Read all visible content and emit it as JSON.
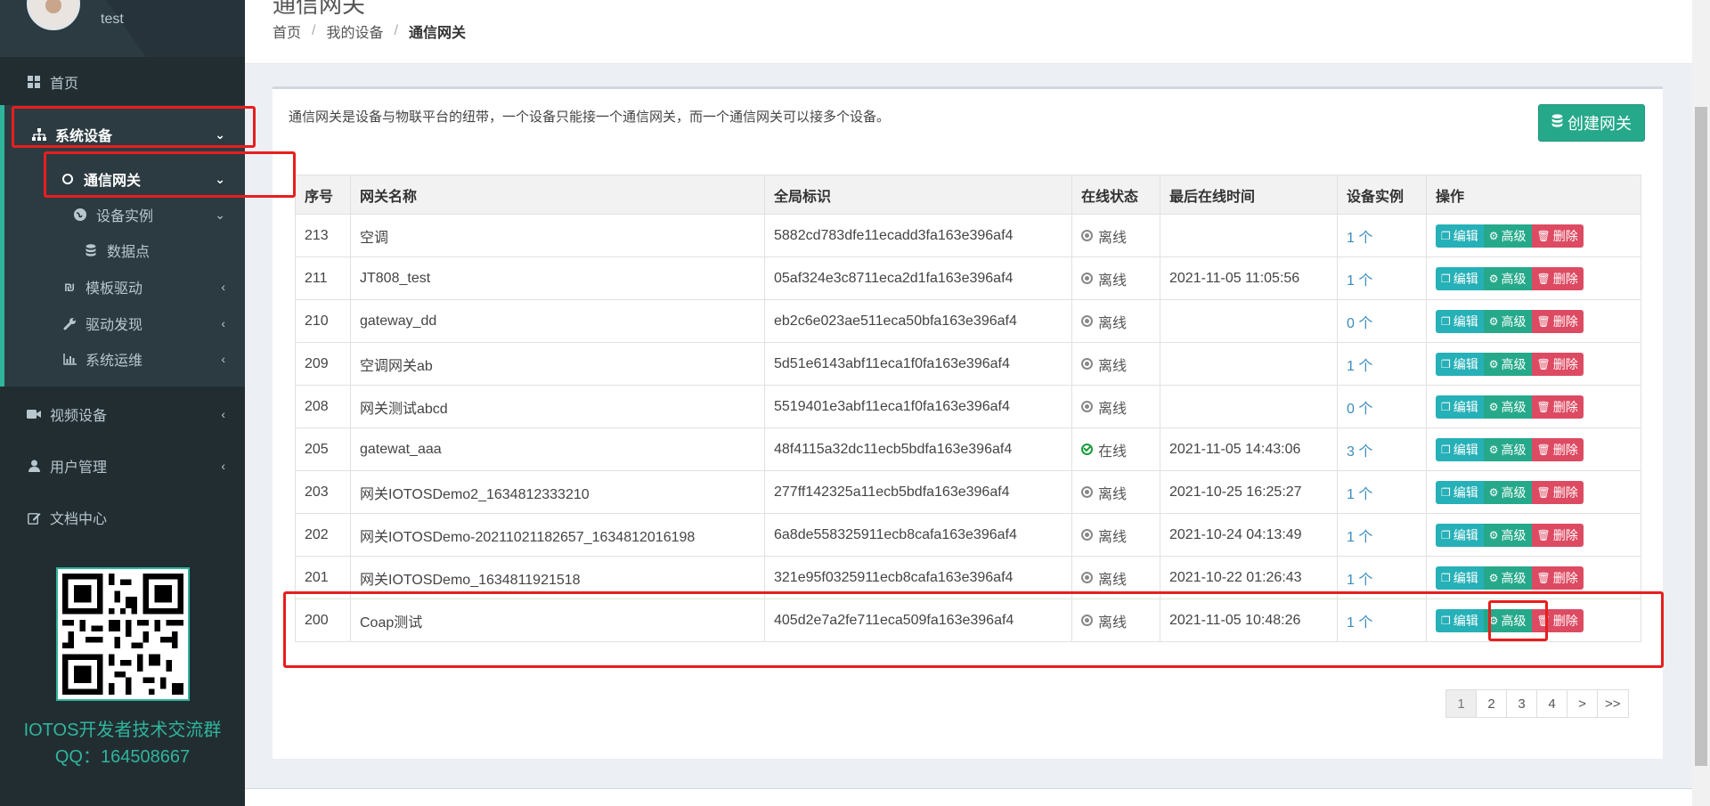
{
  "user": {
    "name": "test"
  },
  "sidebar": {
    "items": [
      {
        "label": "首页",
        "icon": "dashboard-icon"
      },
      {
        "label": "系统设备",
        "icon": "sitemap-icon"
      },
      {
        "label": "通信网关",
        "icon": "circle-icon"
      },
      {
        "label": "设备实例",
        "icon": "globe-icon"
      },
      {
        "label": "数据点",
        "icon": "database-icon"
      },
      {
        "label": "模板驱动",
        "icon": "template-icon"
      },
      {
        "label": "驱动发现",
        "icon": "wrench-icon"
      },
      {
        "label": "系统运维",
        "icon": "chart-icon"
      },
      {
        "label": "视频设备",
        "icon": "video-icon"
      },
      {
        "label": "用户管理",
        "icon": "user-icon"
      },
      {
        "label": "文档中心",
        "icon": "edit-icon"
      }
    ],
    "qr_line1": "IOTOS开发者技术交流群",
    "qr_line2": "QQ：164508667"
  },
  "header": {
    "title": "通信网关",
    "breadcrumb": [
      "首页",
      "我的设备",
      "通信网关"
    ]
  },
  "main": {
    "intro": "通信网关是设备与物联平台的纽带，一个设备只能接一个通信网关，而一个通信网关可以接多个设备。",
    "create_label": "创建网关",
    "columns": [
      "序号",
      "网关名称",
      "全局标识",
      "在线状态",
      "最后在线时间",
      "设备实例",
      "操作"
    ],
    "actions": {
      "edit": "编辑",
      "advanced": "高级",
      "delete": "删除"
    },
    "rows": [
      {
        "no": "213",
        "name": "空调",
        "gid": "5882cd783dfe11ecadd3fa163e396af4",
        "status": "离线",
        "online": false,
        "last": "",
        "count": "1 个"
      },
      {
        "no": "211",
        "name": "JT808_test",
        "gid": "05af324e3c8711eca2d1fa163e396af4",
        "status": "离线",
        "online": false,
        "last": "2021-11-05 11:05:56",
        "count": "1 个"
      },
      {
        "no": "210",
        "name": "gateway_dd",
        "gid": "eb2c6e023ae511eca50bfa163e396af4",
        "status": "离线",
        "online": false,
        "last": "",
        "count": "0 个"
      },
      {
        "no": "209",
        "name": "空调网关ab",
        "gid": "5d51e6143abf11eca1f0fa163e396af4",
        "status": "离线",
        "online": false,
        "last": "",
        "count": "1 个"
      },
      {
        "no": "208",
        "name": "网关测试abcd",
        "gid": "5519401e3abf11eca1f0fa163e396af4",
        "status": "离线",
        "online": false,
        "last": "",
        "count": "0 个"
      },
      {
        "no": "205",
        "name": "gatewat_aaa",
        "gid": "48f4115a32dc11ecb5bdfa163e396af4",
        "status": "在线",
        "online": true,
        "last": "2021-11-05 14:43:06",
        "count": "3 个"
      },
      {
        "no": "203",
        "name": "网关IOTOSDemo2_1634812333210",
        "gid": "277ff142325a11ecb5bdfa163e396af4",
        "status": "离线",
        "online": false,
        "last": "2021-10-25 16:25:27",
        "count": "1 个"
      },
      {
        "no": "202",
        "name": "网关IOTOSDemo-20211021182657_1634812016198",
        "gid": "6a8de558325911ecb8cafa163e396af4",
        "status": "离线",
        "online": false,
        "last": "2021-10-24 04:13:49",
        "count": "1 个"
      },
      {
        "no": "201",
        "name": "网关IOTOSDemo_1634811921518",
        "gid": "321e95f0325911ecb8cafa163e396af4",
        "status": "离线",
        "online": false,
        "last": "2021-10-22 01:26:43",
        "count": "1 个"
      },
      {
        "no": "200",
        "name": "Coap测试",
        "gid": "405d2e7a2fe711eca509fa163e396af4",
        "status": "离线",
        "online": false,
        "last": "2021-11-05 10:48:26",
        "count": "1 个"
      }
    ],
    "pagination": [
      "1",
      "2",
      "3",
      "4",
      ">",
      ">>"
    ],
    "current_page": "1"
  },
  "colors": {
    "accent": "#26a98a",
    "edit": "#26b0b7",
    "delete": "#dd4b62",
    "sidebar_bg": "#222d32",
    "highlight": "#e81e1e",
    "link": "#3c8dbc"
  }
}
